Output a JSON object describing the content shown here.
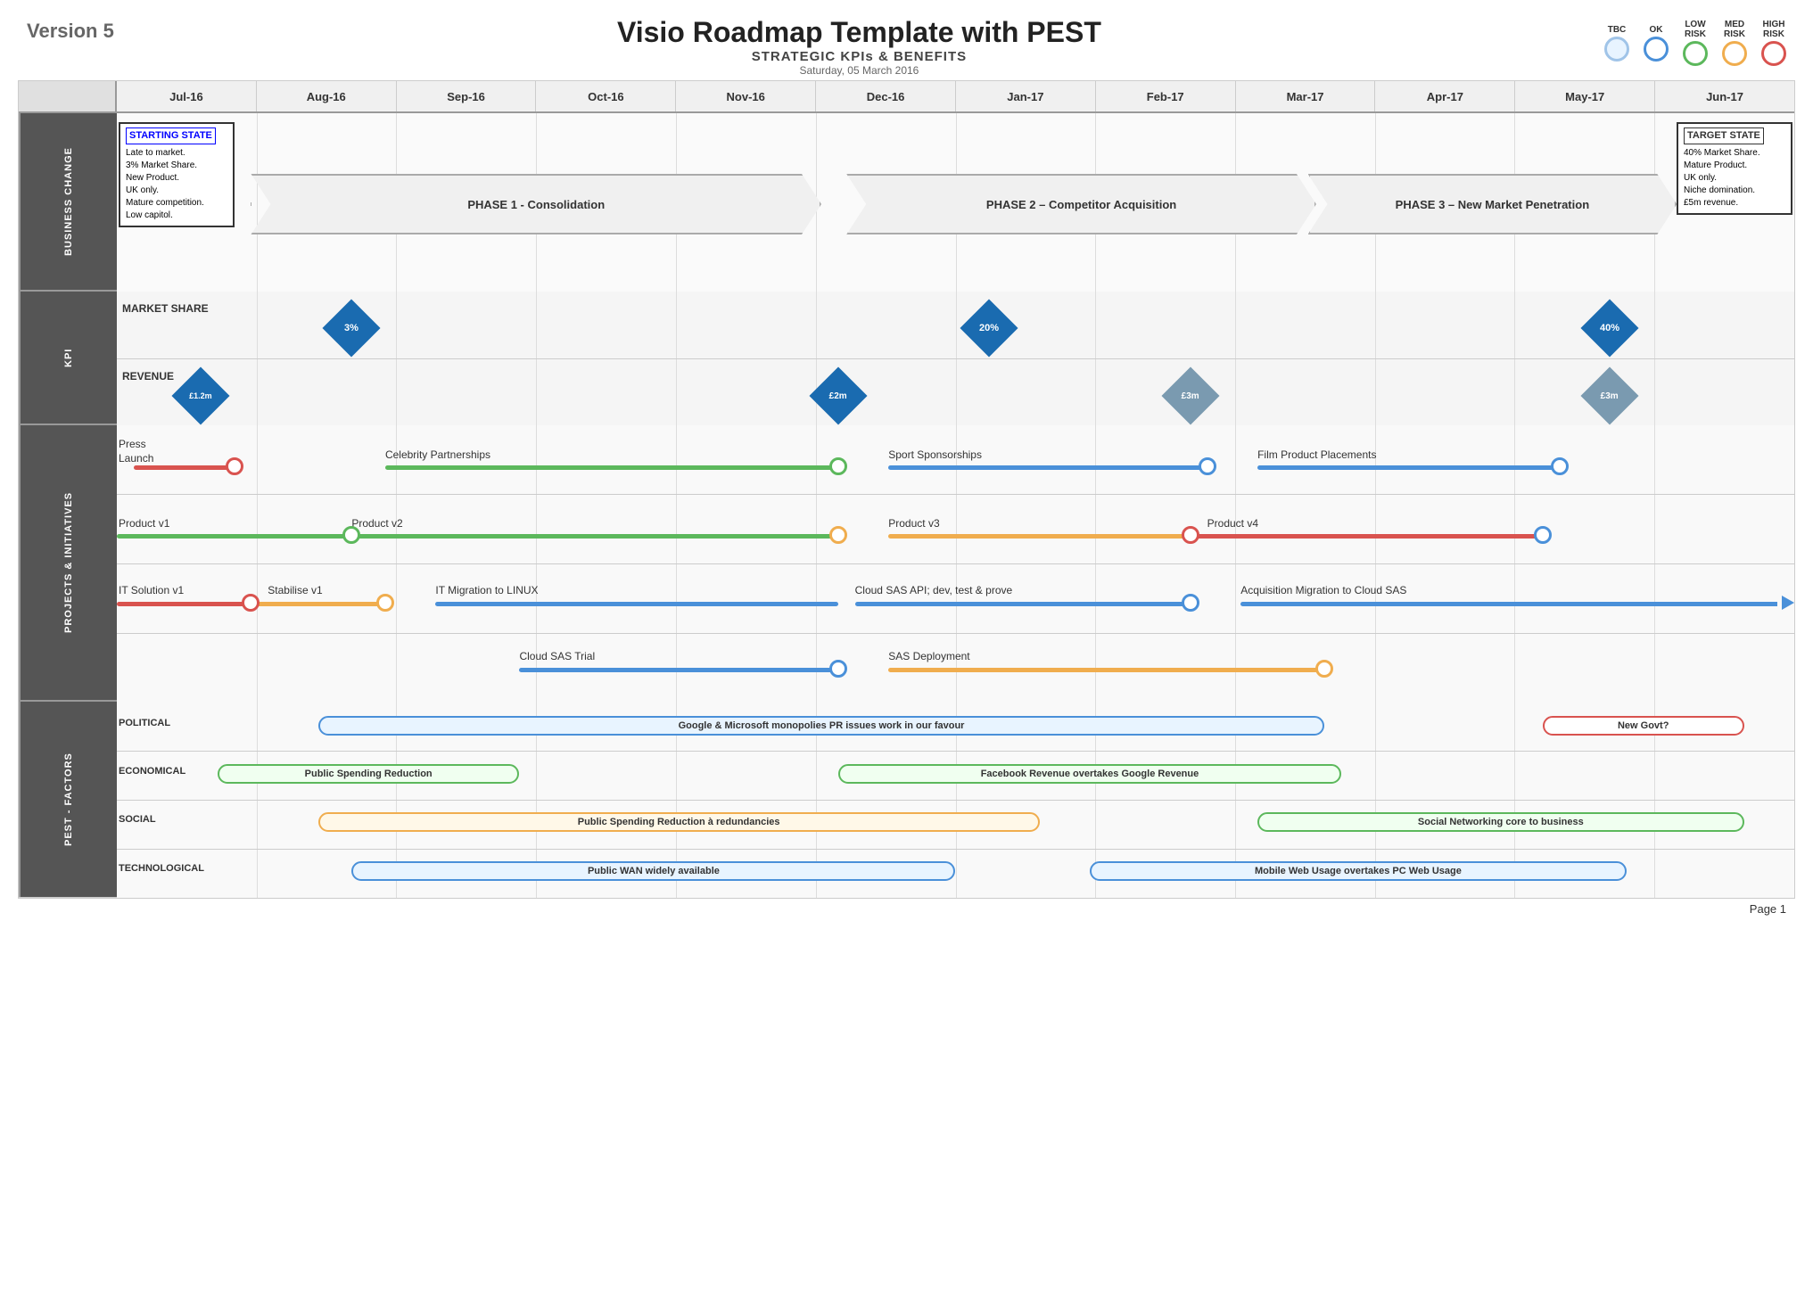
{
  "header": {
    "version": "Version 5",
    "title": "Visio Roadmap Template with PEST",
    "subtitle": "STRATEGIC KPIs & BENEFITS",
    "date": "Saturday, 05 March 2016",
    "legend": [
      {
        "label": "TBC",
        "class": "lc-tbc"
      },
      {
        "label": "OK",
        "class": "lc-ok"
      },
      {
        "label": "LOW\nRISK",
        "class": "lc-low"
      },
      {
        "label": "MED\nRISK",
        "class": "lc-med"
      },
      {
        "label": "HIGH\nRISK",
        "class": "lc-high"
      }
    ]
  },
  "months": [
    "Jul-16",
    "Aug-16",
    "Sep-16",
    "Oct-16",
    "Nov-16",
    "Dec-16",
    "Jan-17",
    "Feb-17",
    "Mar-17",
    "Apr-17",
    "May-17",
    "Jun-17"
  ],
  "sections": {
    "business_change": {
      "label": "BUSINESS CHANGE",
      "starting_state": {
        "title": "STARTING STATE",
        "lines": [
          "Late to market.",
          "3% Market Share.",
          "New Product.",
          "UK only.",
          "Mature competition.",
          "Low capitol."
        ]
      },
      "target_state": {
        "title": "TARGET STATE",
        "lines": [
          "40% Market Share.",
          "Mature Product.",
          "UK only.",
          "Niche domination.",
          "£5m revenue."
        ]
      },
      "phases": [
        {
          "label": "PHASE 1 - Consolidation",
          "start_pct": 8,
          "width_pct": 36
        },
        {
          "label": "PHASE 2 – Competitor Acquisition",
          "start_pct": 44,
          "width_pct": 28
        },
        {
          "label": "PHASE 3 – New Market Penetration",
          "start_pct": 72,
          "width_pct": 22
        }
      ]
    },
    "kpi": {
      "label": "KPI",
      "rows": [
        {
          "name": "MARKET SHARE",
          "diamonds": [
            {
              "label": "3%",
              "pos_pct": 14
            },
            {
              "label": "20%",
              "pos_pct": 52
            },
            {
              "label": "40%",
              "pos_pct": 89
            }
          ]
        },
        {
          "name": "REVENUE",
          "diamonds": [
            {
              "label": "£1.2m",
              "pos_pct": 5
            },
            {
              "label": "£2m",
              "pos_pct": 43
            },
            {
              "label": "£3m",
              "pos_pct": 64
            },
            {
              "label": "£3m",
              "pos_pct": 89
            }
          ]
        }
      ]
    },
    "projects": {
      "label": "PROJECTS & INITIATIVES",
      "items": [
        {
          "label": "Press\nLaunch",
          "type": "dot_line",
          "color": "#d9534f",
          "start_pct": 2,
          "end_pct": 8,
          "dot_at": "end",
          "label_pos": "start"
        },
        {
          "label": "Celebrity Partnerships",
          "type": "line_dot",
          "color": "#5cb85c",
          "start_pct": 16,
          "end_pct": 43,
          "dot_at": "end",
          "label_pos": "start"
        },
        {
          "label": "Sport Sponsorships",
          "type": "line_dot",
          "color": "#4a90d9",
          "start_pct": 46,
          "end_pct": 65,
          "dot_at": "end",
          "label_pos": "start"
        },
        {
          "label": "Film Product Placements",
          "type": "line_dot",
          "color": "#4a90d9",
          "start_pct": 68,
          "end_pct": 86,
          "dot_at": "end",
          "label_pos": "start"
        }
      ],
      "items2": [
        {
          "label": "Product v1",
          "color": "#5cb85c",
          "start_pct": 0,
          "end_pct": 14
        },
        {
          "label": "Product v2",
          "color": "#5cb85c",
          "start_pct": 14,
          "end_pct": 43
        },
        {
          "label": "Product v3",
          "color": "#f0ad4e",
          "start_pct": 43,
          "end_pct": 64
        },
        {
          "label": "Product v4",
          "color": "#d9534f",
          "start_pct": 64,
          "end_pct": 85
        }
      ],
      "items3": [
        {
          "label": "IT Solution v1",
          "color": "#d9534f",
          "start_pct": 0,
          "end_pct": 8
        },
        {
          "label": "Stabilise v1",
          "color": "#f0ad4e",
          "start_pct": 8,
          "end_pct": 16
        },
        {
          "label": "IT Migration to LINUX",
          "color": "#4a90d9",
          "start_pct": 19,
          "end_pct": 43
        },
        {
          "label": "Cloud SAS API; dev, test & prove",
          "color": "#4a90d9",
          "start_pct": 46,
          "end_pct": 66
        },
        {
          "label": "Acquisition Migration to Cloud SAS",
          "color": "#4a90d9",
          "start_pct": 68,
          "end_pct": 100,
          "arrow": true
        }
      ],
      "items4": [
        {
          "label": "Cloud SAS Trial",
          "color": "#4a90d9",
          "start_pct": 24,
          "end_pct": 43
        },
        {
          "label": "SAS Deployment",
          "color": "#f0ad4e",
          "start_pct": 46,
          "end_pct": 72
        }
      ]
    },
    "pest": {
      "label": "PEST - FACTORS",
      "rows": [
        {
          "factor": "POLITICAL",
          "bars": [
            {
              "label": "Google & Microsoft monopolies PR issues work in our favour",
              "start_pct": 12,
              "width_pct": 60,
              "border_color": "#4a90d9",
              "bg": "#e8f4ff"
            },
            {
              "label": "New Govt?",
              "start_pct": 85,
              "width_pct": 11,
              "border_color": "#d9534f",
              "bg": "#fff"
            }
          ]
        },
        {
          "factor": "ECONOMICAL",
          "bars": [
            {
              "label": "Public Spending Reduction",
              "start_pct": 6,
              "width_pct": 18,
              "border_color": "#5cb85c",
              "bg": "#f0fff0"
            },
            {
              "label": "Facebook Revenue overtakes Google Revenue",
              "start_pct": 43,
              "width_pct": 30,
              "border_color": "#5cb85c",
              "bg": "#f0fff0"
            }
          ]
        },
        {
          "factor": "SOCIAL",
          "bars": [
            {
              "label": "Public Spending Reduction à redundancies",
              "start_pct": 12,
              "width_pct": 43,
              "border_color": "#f0ad4e",
              "bg": "#fff8e8"
            },
            {
              "label": "Social Networking core to business",
              "start_pct": 68,
              "width_pct": 29,
              "border_color": "#5cb85c",
              "bg": "#f0fff0"
            }
          ]
        },
        {
          "factor": "TECHNOLOGICAL",
          "bars": [
            {
              "label": "Public WAN widely available",
              "start_pct": 14,
              "width_pct": 36,
              "border_color": "#4a90d9",
              "bg": "#e8f4ff"
            },
            {
              "label": "Mobile Web Usage overtakes PC Web Usage",
              "start_pct": 58,
              "width_pct": 32,
              "border_color": "#4a90d9",
              "bg": "#e8f4ff"
            }
          ]
        }
      ]
    }
  },
  "footer": {
    "page": "Page 1"
  }
}
